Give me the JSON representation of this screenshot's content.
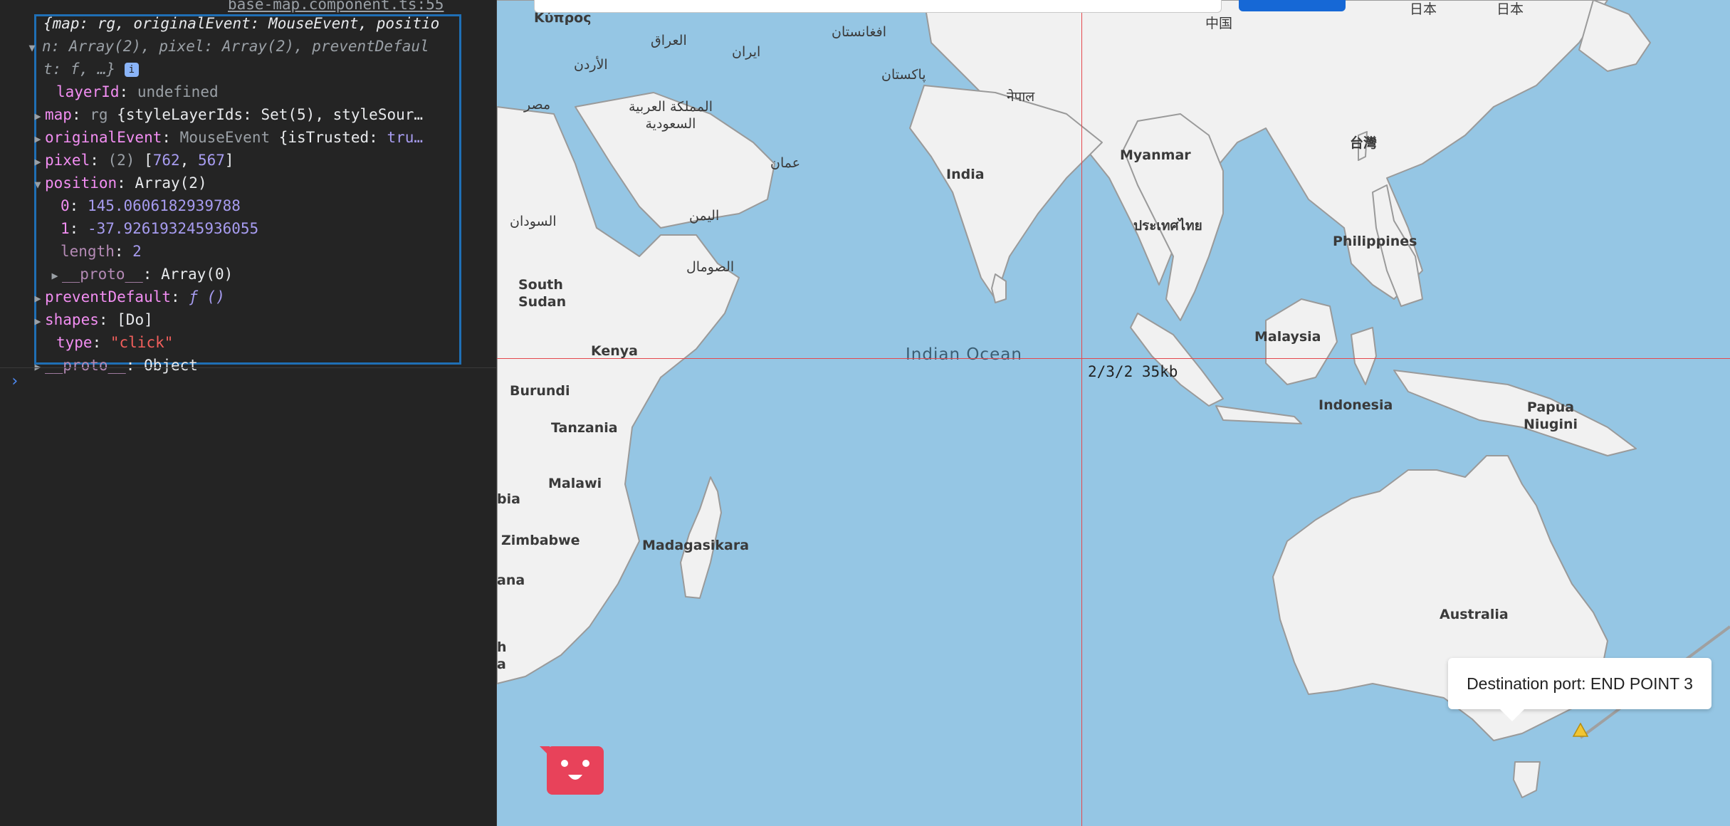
{
  "console": {
    "source_link": "base-map.component.ts:55",
    "summary_line1": "{map: rg, originalEvent: MouseEvent, positio",
    "summary_line2": "n: Array(2), pixel: Array(2), preventDefaul",
    "summary_line3": "t: f, …}",
    "info_badge": "i",
    "properties": [
      {
        "key": "layerId",
        "sep": ": ",
        "value": "undefined"
      },
      {
        "key": "map",
        "sep": ": ",
        "value": "rg {styleLayerIds: Set(5), styleSour…"
      },
      {
        "key": "originalEvent",
        "sep": ": ",
        "value": "MouseEvent {isTrusted: tru…"
      },
      {
        "key": "pixel",
        "sep": ": ",
        "value_prefix": "(2) ",
        "value": "[762, 567]"
      },
      {
        "key": "position",
        "sep": ": ",
        "value": "Array(2)"
      },
      {
        "key": "0",
        "sep": ": ",
        "value": "145.0606182939788"
      },
      {
        "key": "1",
        "sep": ": ",
        "value": "-37.926193245936055"
      },
      {
        "key": "length",
        "sep": ": ",
        "value": "2"
      },
      {
        "key": "__proto__",
        "sep": ": ",
        "value": "Array(0)"
      },
      {
        "key": "preventDefault",
        "sep": ": ",
        "value": "ƒ ()"
      },
      {
        "key": "shapes",
        "sep": ": ",
        "value": "[Do]"
      },
      {
        "key": "type",
        "sep": ": ",
        "value": "\"click\""
      },
      {
        "key": "__proto__",
        "sep": ": ",
        "value": "Object"
      }
    ],
    "prompt_symbol": "›"
  },
  "map": {
    "ocean_label": "Indian Ocean",
    "tile_debug": "2/3/2 35kb",
    "popup_text": "Destination port: END POINT 3",
    "labels": {
      "kypros": "Κύπρος",
      "iraq": "العراق",
      "iran": "ایران",
      "afghanistan": "افغانستان",
      "pakistan": "پاکستان",
      "china": "中国",
      "japan_kana": "日本",
      "japan2": "日本",
      "jordan": "الأردن",
      "egypt": "مصر",
      "saudi": "المملكة العربية السعودية",
      "oman": "عمان",
      "yemen": "اليمن",
      "sudan": "السودان",
      "somalia": "الصومال",
      "nepal": "नेपाल",
      "india": "India",
      "myanmar": "Myanmar",
      "thailand": "ประเทศไทย",
      "taiwan": "台灣",
      "philippines": "Philippines",
      "malaysia": "Malaysia",
      "indonesia": "Indonesia",
      "png": "Papua Niugini",
      "australia": "Australia",
      "south_sudan": "South Sudan",
      "kenya": "Kenya",
      "burundi": "Burundi",
      "tanzania": "Tanzania",
      "malawi": "Malawi",
      "zambia_frag": "bia",
      "zimbabwe": "Zimbabwe",
      "madagascar": "Madagasikara",
      "botswana_frag": "ana",
      "sa_frag1": "h",
      "sa_frag2": "a"
    }
  }
}
